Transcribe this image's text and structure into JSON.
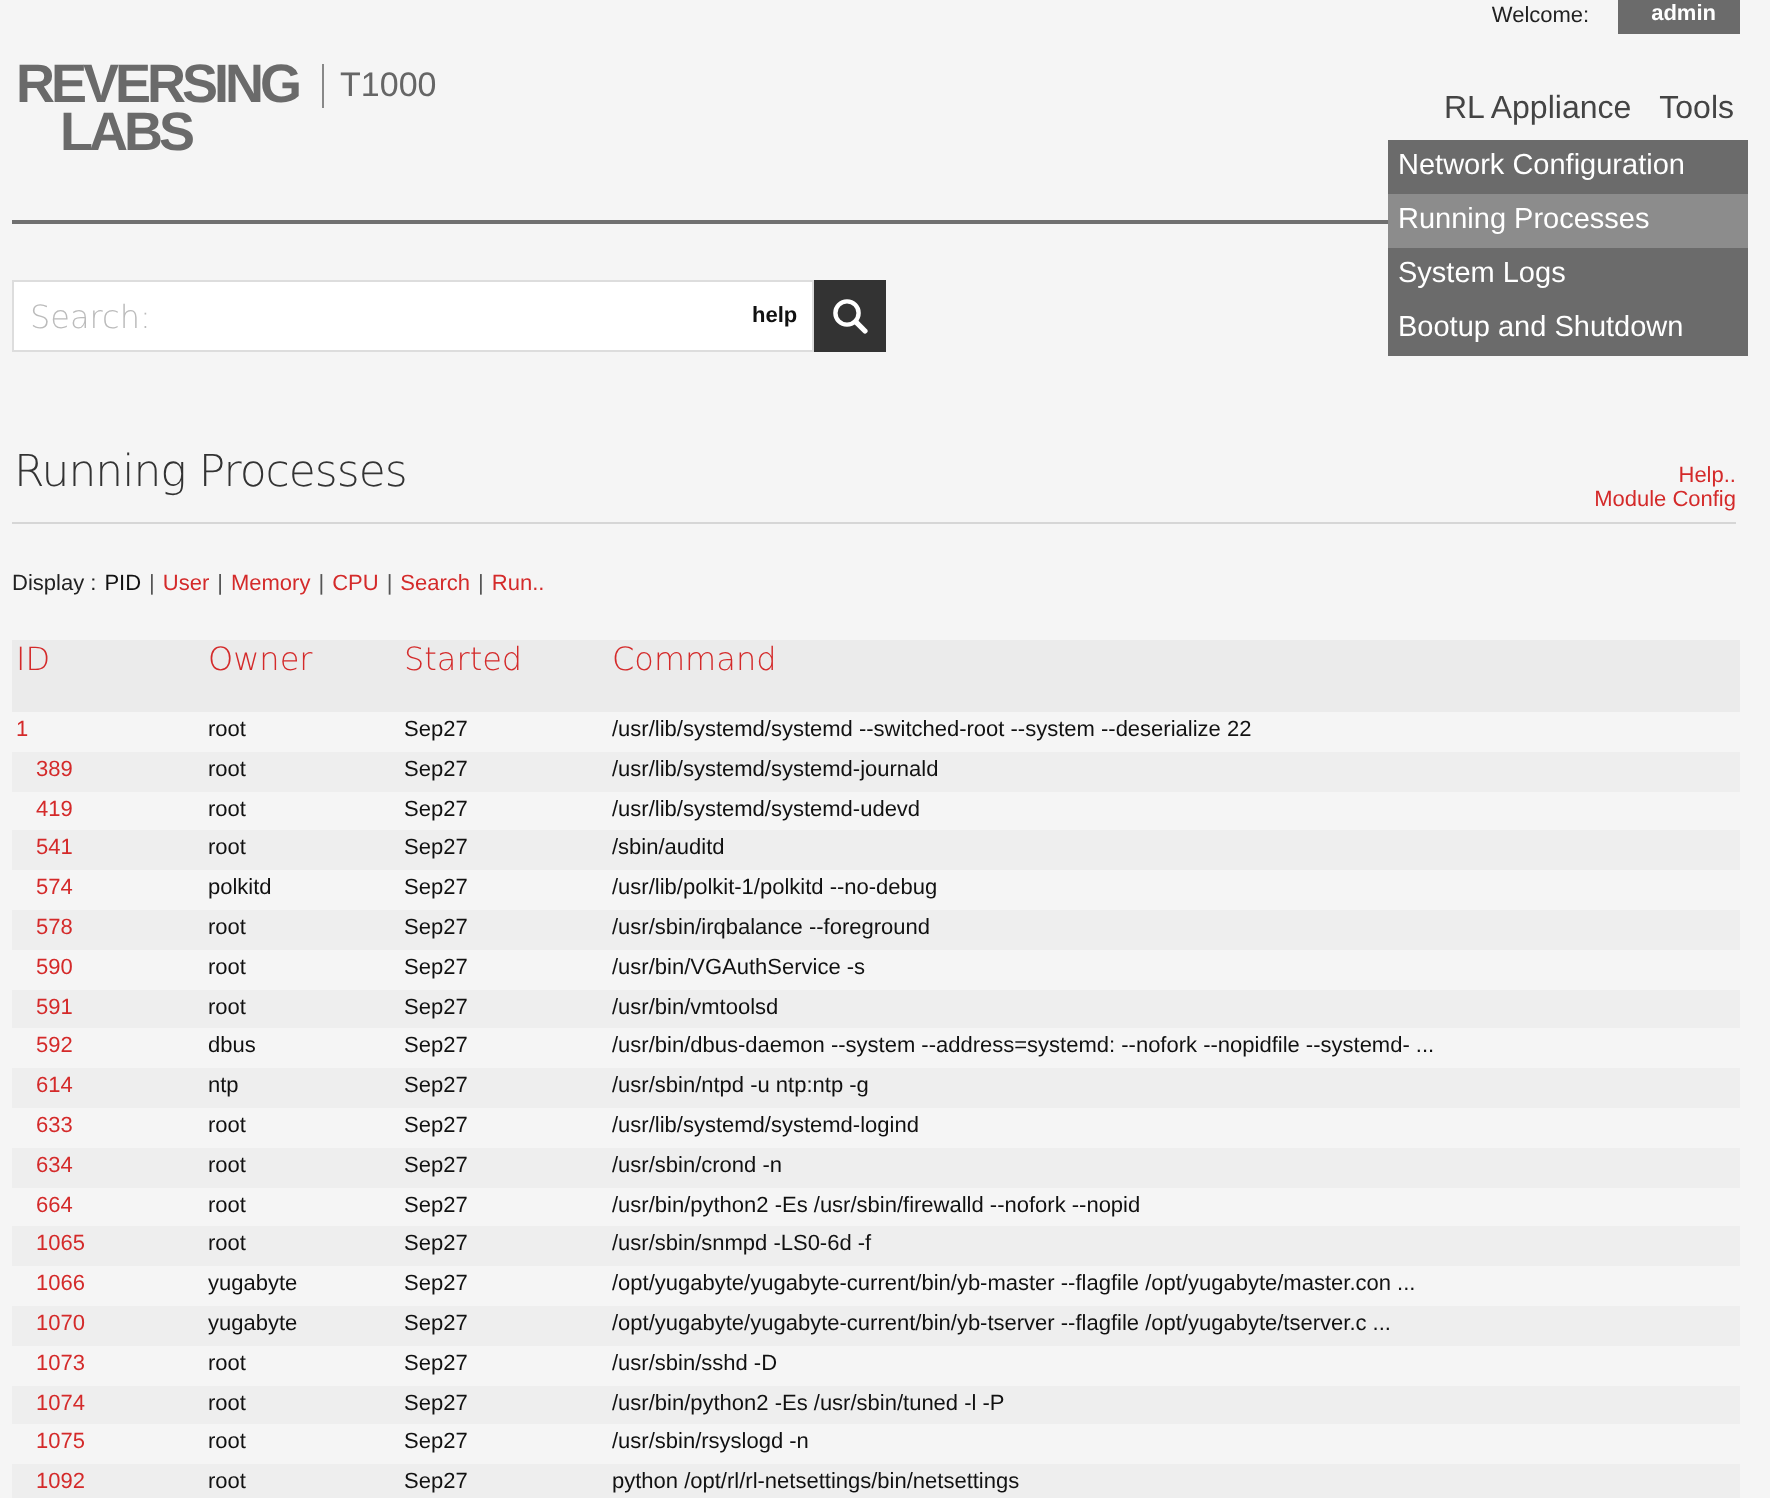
{
  "header": {
    "welcome_label": "Welcome:",
    "user": "admin",
    "logo_line_1": "REVERSING",
    "logo_line_2": "LABS",
    "product": "T1000",
    "nav": [
      {
        "label": "RL Appliance"
      },
      {
        "label": "Tools"
      }
    ],
    "menu": [
      {
        "label": "Network Configuration",
        "selected": false
      },
      {
        "label": "Running Processes",
        "selected": true
      },
      {
        "label": "System Logs",
        "selected": false
      },
      {
        "label": "Bootup and Shutdown",
        "selected": false
      }
    ]
  },
  "search": {
    "placeholder": "Search:",
    "help": "help"
  },
  "page": {
    "title": "Running Processes",
    "links": [
      "Help..",
      "Module Config"
    ]
  },
  "display": {
    "label": "Display :",
    "separator": "|",
    "options": [
      {
        "label": "PID",
        "selected": true
      },
      {
        "label": "User",
        "selected": false
      },
      {
        "label": "Memory",
        "selected": false
      },
      {
        "label": "CPU",
        "selected": false
      },
      {
        "label": "Search",
        "selected": false
      },
      {
        "label": "Run..",
        "selected": false
      }
    ]
  },
  "table": {
    "columns": [
      "ID",
      "Owner",
      "Started",
      "Command"
    ],
    "rows": [
      {
        "id": "1",
        "owner": "root",
        "started": "Sep27",
        "command": "/usr/lib/systemd/systemd --switched-root --system --deserialize 22",
        "children": [
          {
            "id": "389",
            "owner": "root",
            "started": "Sep27",
            "command": "/usr/lib/systemd/systemd-journald"
          },
          {
            "id": "419",
            "owner": "root",
            "started": "Sep27",
            "command": "/usr/lib/systemd/systemd-udevd"
          },
          {
            "id": "541",
            "owner": "root",
            "started": "Sep27",
            "command": "/sbin/auditd"
          },
          {
            "id": "574",
            "owner": "polkitd",
            "started": "Sep27",
            "command": "/usr/lib/polkit-1/polkitd --no-debug"
          },
          {
            "id": "578",
            "owner": "root",
            "started": "Sep27",
            "command": "/usr/sbin/irqbalance --foreground"
          },
          {
            "id": "590",
            "owner": "root",
            "started": "Sep27",
            "command": "/usr/bin/VGAuthService -s"
          },
          {
            "id": "591",
            "owner": "root",
            "started": "Sep27",
            "command": "/usr/bin/vmtoolsd"
          },
          {
            "id": "592",
            "owner": "dbus",
            "started": "Sep27",
            "command": "/usr/bin/dbus-daemon --system --address=systemd: --nofork --nopidfile --systemd- ..."
          },
          {
            "id": "614",
            "owner": "ntp",
            "started": "Sep27",
            "command": "/usr/sbin/ntpd -u ntp:ntp -g"
          },
          {
            "id": "633",
            "owner": "root",
            "started": "Sep27",
            "command": "/usr/lib/systemd/systemd-logind"
          },
          {
            "id": "634",
            "owner": "root",
            "started": "Sep27",
            "command": "/usr/sbin/crond -n"
          },
          {
            "id": "664",
            "owner": "root",
            "started": "Sep27",
            "command": "/usr/bin/python2 -Es /usr/sbin/firewalld --nofork --nopid"
          },
          {
            "id": "1065",
            "owner": "root",
            "started": "Sep27",
            "command": "/usr/sbin/snmpd -LS0-6d -f"
          },
          {
            "id": "1066",
            "owner": "yugabyte",
            "started": "Sep27",
            "command": "/opt/yugabyte/yugabyte-current/bin/yb-master --flagfile /opt/yugabyte/master.con ..."
          },
          {
            "id": "1070",
            "owner": "yugabyte",
            "started": "Sep27",
            "command": "/opt/yugabyte/yugabyte-current/bin/yb-tserver --flagfile /opt/yugabyte/tserver.c ..."
          },
          {
            "id": "1073",
            "owner": "root",
            "started": "Sep27",
            "command": "/usr/sbin/sshd -D"
          },
          {
            "id": "1074",
            "owner": "root",
            "started": "Sep27",
            "command": "/usr/bin/python2 -Es /usr/sbin/tuned -l -P"
          },
          {
            "id": "1075",
            "owner": "root",
            "started": "Sep27",
            "command": "/usr/sbin/rsyslogd -n"
          },
          {
            "id": "1092",
            "owner": "root",
            "started": "Sep27",
            "command": "python /opt/rl/rl-netsettings/bin/netsettings"
          }
        ]
      }
    ]
  }
}
